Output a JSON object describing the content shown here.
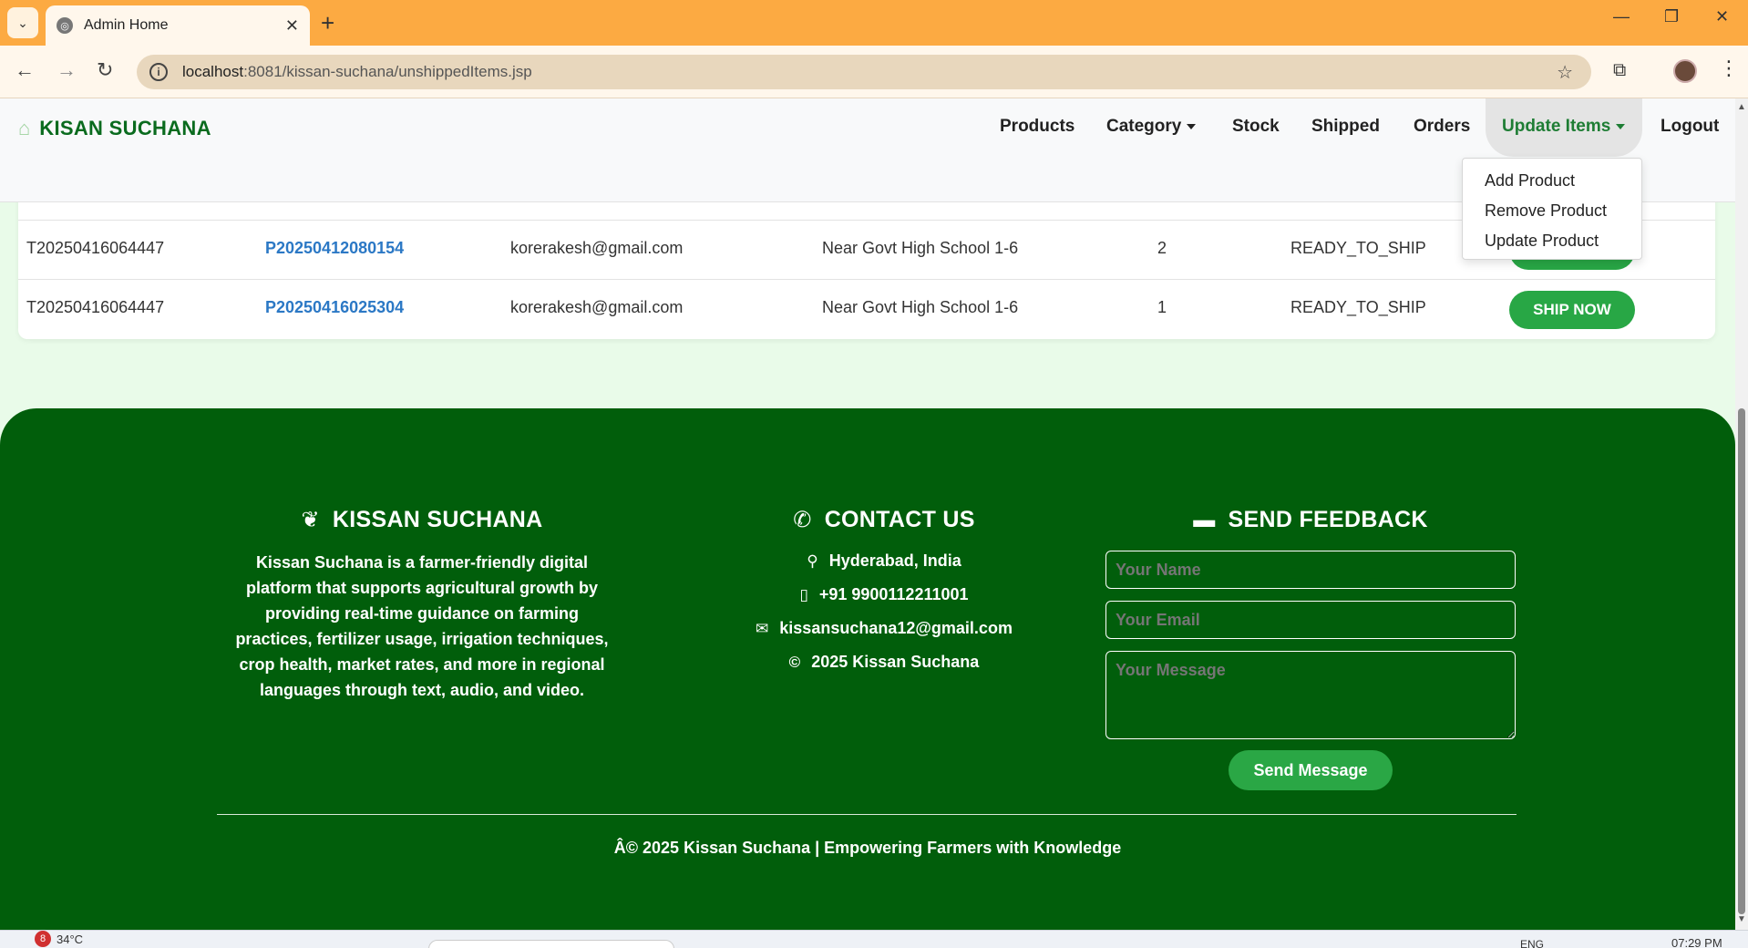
{
  "browser": {
    "tab_title": "Admin Home",
    "tab_close": "✕",
    "new_tab": "+",
    "url_host": "localhost",
    "url_rest": ":8081/kissan-suchana/unshippedItems.jsp",
    "window_controls": [
      "—",
      "❐",
      "✕"
    ]
  },
  "navbar": {
    "brand": "KISAN SUCHANA",
    "links": {
      "products": "Products",
      "category": "Category",
      "stock": "Stock",
      "shipped": "Shipped",
      "orders": "Orders",
      "update_items": "Update Items",
      "logout": "Logout"
    },
    "dropdown": [
      "Add Product",
      "Remove Product",
      "Update Product"
    ]
  },
  "table": {
    "rows": [
      {
        "transaction_id": "T20250416064447",
        "product_id": "P20250412080154",
        "email": "korerakesh@gmail.com",
        "address": "Near Govt High School 1-6",
        "quantity": "2",
        "status": "READY_TO_SHIP",
        "action": "SHIP NOW"
      },
      {
        "transaction_id": "T20250416064447",
        "product_id": "P20250416025304",
        "email": "korerakesh@gmail.com",
        "address": "Near Govt High School 1-6",
        "quantity": "1",
        "status": "READY_TO_SHIP",
        "action": "SHIP NOW"
      }
    ]
  },
  "footer": {
    "about": {
      "title": "KISSAN SUCHANA",
      "text": "Kissan Suchana is a farmer-friendly digital platform that supports agricultural growth by providing real-time guidance on farming practices, fertilizer usage, irrigation techniques, crop health, market rates, and more in regional languages through text, audio, and video."
    },
    "contact": {
      "title": "CONTACT US",
      "location": "Hyderabad, India",
      "phone": "+91 9900112211001",
      "email": "kissansuchana12@gmail.com",
      "copyright": "2025 Kissan Suchana"
    },
    "feedback": {
      "title": "SEND FEEDBACK",
      "name_placeholder": "Your Name",
      "email_placeholder": "Your Email",
      "message_placeholder": "Your Message",
      "button": "Send Message"
    },
    "bottom": "Â© 2025 Kissan Suchana | Empowering Farmers with Knowledge"
  },
  "taskbar": {
    "weather": "34°C",
    "badge": "8",
    "lang": "ENG",
    "time": "07:29 PM"
  },
  "colors": {
    "tabbar": "#fcaa42",
    "brand_green": "#0a6b1e",
    "footer_bg": "#015e0b",
    "button_green": "#28a745",
    "link_blue": "#2b78c5"
  }
}
